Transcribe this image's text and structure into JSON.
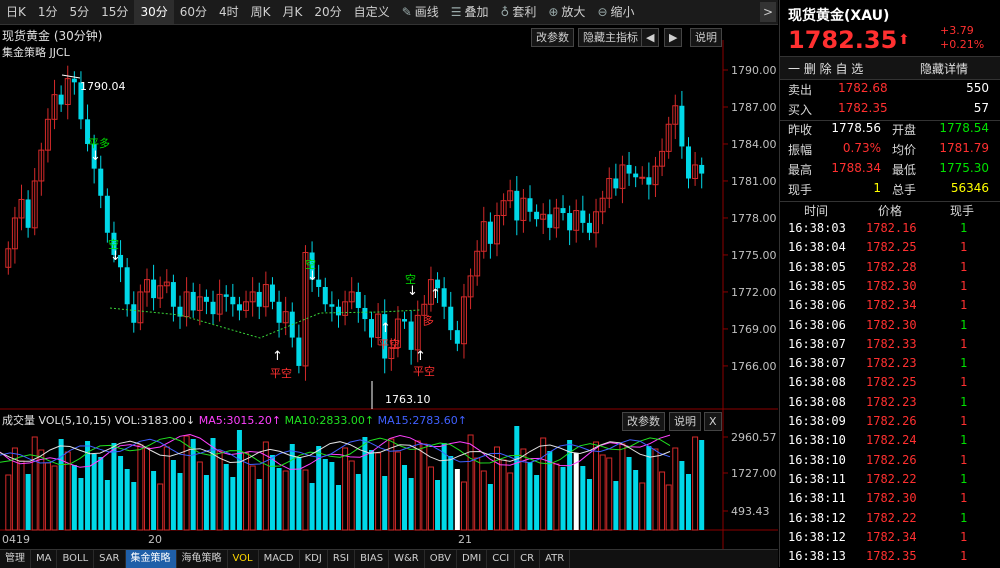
{
  "toolbar": {
    "items": [
      "日K",
      "1分",
      "5分",
      "15分",
      "30分",
      "60分",
      "4时",
      "周K",
      "月K",
      "20分",
      "自定义",
      "画线",
      "叠加",
      "套利",
      "放大",
      "缩小"
    ],
    "active": "30分",
    "arrow": ">"
  },
  "chart": {
    "title": "现货黄金 (30分钟)",
    "strategy": "集金策略 JJCL",
    "buttons": [
      "改参数",
      "隐藏主指标",
      "◀",
      "▶",
      "说明"
    ],
    "price_ticks": [
      "1790.00",
      "1787.00",
      "1784.00",
      "1781.00",
      "1778.00",
      "1775.00",
      "1772.00",
      "1769.00",
      "1766.00"
    ],
    "high_label": "1790.04",
    "low_label": "1763.10",
    "signals": [
      "平多",
      "空",
      "空",
      "空",
      "平空",
      "平空",
      "平空",
      "多"
    ],
    "date_labels": [
      "0419",
      "20",
      "21"
    ]
  },
  "volume": {
    "title": "成交量 VOL(5,10,15)",
    "vol": "VOL:3183.00↓",
    "ma5": "MA5:3015.20↑",
    "ma10": "MA10:2833.00↑",
    "ma15": "MA15:2783.60↑",
    "buttons": [
      "改参数",
      "说明",
      "X"
    ],
    "ticks": [
      "2960.57",
      "1727.00",
      "493.43"
    ]
  },
  "bottom_tabs": [
    "管理",
    "MA",
    "BOLL",
    "SAR",
    "集金策略",
    "海龟策略",
    "VOL",
    "MACD",
    "KDJ",
    "RSI",
    "BIAS",
    "W&R",
    "OBV",
    "DMI",
    "CCI",
    "CR",
    "ATR"
  ],
  "quote": {
    "name": "现货黄金(XAU)",
    "price": "1782.35",
    "arrow": "⬆",
    "change": "+3.79",
    "change_pct": "+0.21%",
    "delete_btn": "一 删 除 自 选",
    "hide_btn": "隐藏详情",
    "sell_label": "卖出",
    "sell_price": "1782.68",
    "sell_qty": "550",
    "buy_label": "买入",
    "buy_price": "1782.35",
    "buy_qty": "57",
    "stats": [
      {
        "l1": "昨收",
        "v1": "1778.56",
        "c1": "white",
        "l2": "开盘",
        "v2": "1778.54",
        "c2": "green"
      },
      {
        "l1": "振幅",
        "v1": "0.73%",
        "c1": "red",
        "l2": "均价",
        "v2": "1781.79",
        "c2": "red"
      },
      {
        "l1": "最高",
        "v1": "1788.34",
        "c1": "red",
        "l2": "最低",
        "v2": "1775.30",
        "c2": "green"
      },
      {
        "l1": "现手",
        "v1": "1",
        "c1": "yellow",
        "l2": "总手",
        "v2": "56346",
        "c2": "yellow"
      }
    ],
    "trade_headers": [
      "时间",
      "价格",
      "现手"
    ],
    "trades": [
      {
        "t": "16:38:03",
        "p": "1782.16",
        "q": "1",
        "qc": "green"
      },
      {
        "t": "16:38:04",
        "p": "1782.25",
        "q": "1",
        "qc": "red"
      },
      {
        "t": "16:38:05",
        "p": "1782.28",
        "q": "1",
        "qc": "red"
      },
      {
        "t": "16:38:05",
        "p": "1782.30",
        "q": "1",
        "qc": "red"
      },
      {
        "t": "16:38:06",
        "p": "1782.34",
        "q": "1",
        "qc": "red"
      },
      {
        "t": "16:38:06",
        "p": "1782.30",
        "q": "1",
        "qc": "green"
      },
      {
        "t": "16:38:07",
        "p": "1782.33",
        "q": "1",
        "qc": "red"
      },
      {
        "t": "16:38:07",
        "p": "1782.23",
        "q": "1",
        "qc": "green"
      },
      {
        "t": "16:38:08",
        "p": "1782.25",
        "q": "1",
        "qc": "red"
      },
      {
        "t": "16:38:08",
        "p": "1782.23",
        "q": "1",
        "qc": "green"
      },
      {
        "t": "16:38:09",
        "p": "1782.26",
        "q": "1",
        "qc": "red"
      },
      {
        "t": "16:38:10",
        "p": "1782.24",
        "q": "1",
        "qc": "green"
      },
      {
        "t": "16:38:10",
        "p": "1782.26",
        "q": "1",
        "qc": "red"
      },
      {
        "t": "16:38:11",
        "p": "1782.22",
        "q": "1",
        "qc": "green"
      },
      {
        "t": "16:38:11",
        "p": "1782.30",
        "q": "1",
        "qc": "red"
      },
      {
        "t": "16:38:12",
        "p": "1782.22",
        "q": "1",
        "qc": "green"
      },
      {
        "t": "16:38:12",
        "p": "1782.34",
        "q": "1",
        "qc": "red"
      },
      {
        "t": "16:38:13",
        "p": "1782.35",
        "q": "1",
        "qc": "red"
      }
    ]
  },
  "colors": {
    "up": "#d42a2a",
    "down": "#00d8e8",
    "bg": "#000000",
    "grid": "#3a0000"
  }
}
